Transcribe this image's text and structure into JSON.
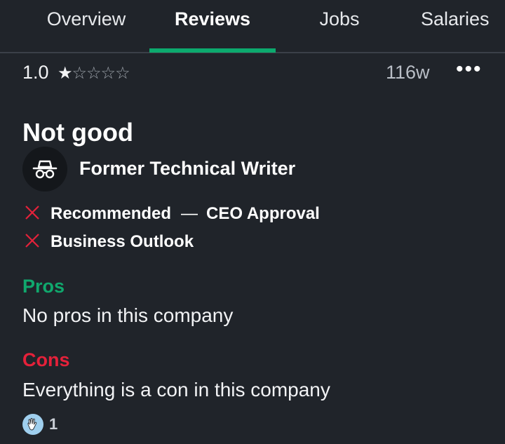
{
  "tabs": [
    {
      "label": "Overview",
      "active": false
    },
    {
      "label": "Reviews",
      "active": true
    },
    {
      "label": "Jobs",
      "active": false
    },
    {
      "label": "Salaries",
      "active": false
    }
  ],
  "colors": {
    "accent_green": "#0caa6e",
    "pros_green": "#10a86d",
    "cons_red": "#e5213a",
    "background": "#20242a"
  },
  "review": {
    "rating": "1.0",
    "stars_filled": 1,
    "stars_total": 5,
    "star_filled_glyph": "★",
    "star_empty_glyph": "☆☆☆☆",
    "age": "116w",
    "more_icon": "•••",
    "title": "Not good",
    "reviewer_icon": "incognito-icon",
    "reviewer": "Former Technical Writer",
    "metrics": {
      "recommended": {
        "label": "Recommended",
        "status": "negative"
      },
      "separator": "—",
      "ceo_approval": {
        "label": "CEO Approval",
        "status": "neutral"
      },
      "business_outlook": {
        "label": "Business Outlook",
        "status": "negative"
      }
    },
    "pros_title": "Pros",
    "pros_text": "No pros in this company",
    "cons_title": "Cons",
    "cons_text": "Everything is a con in this company",
    "helpful_icon": "clapping-hands-icon",
    "helpful_count": "1"
  }
}
